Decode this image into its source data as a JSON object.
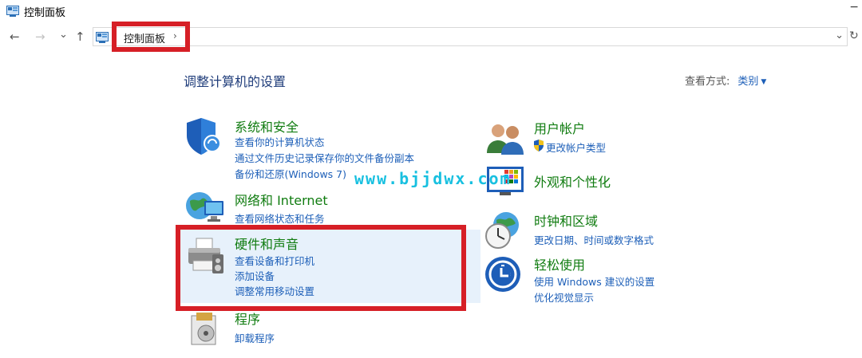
{
  "window": {
    "title": "控制面板",
    "minimize_glyph": "−"
  },
  "nav": {
    "back_glyph": "←",
    "forward_glyph": "→",
    "recent_glyph": "⌄",
    "up_glyph": "↑",
    "breadcrumb": "控制面板",
    "breadcrumb_chevron": "›",
    "address_dropdown": "⌄",
    "refresh_glyph": "↻"
  },
  "main": {
    "heading": "调整计算机的设置",
    "view_by_label": "查看方式:",
    "view_by_value": "类别",
    "view_by_caret": "▼"
  },
  "categories": [
    {
      "title": "系统和安全",
      "icon": "shield-icon",
      "links": [
        "查看你的计算机状态",
        "通过文件历史记录保存你的文件备份副本",
        "备份和还原(Windows 7)"
      ]
    },
    {
      "title": "网络和 Internet",
      "icon": "network-globe-icon",
      "links": [
        "查看网络状态和任务"
      ]
    },
    {
      "title": "硬件和声音",
      "icon": "printer-icon",
      "links": [
        "查看设备和打印机",
        "添加设备",
        "调整常用移动设置"
      ]
    },
    {
      "title": "程序",
      "icon": "programs-icon",
      "links": [
        "卸载程序"
      ]
    },
    {
      "title": "用户帐户",
      "icon": "users-icon",
      "links": [
        "更改帐户类型"
      ]
    },
    {
      "title": "外观和个性化",
      "icon": "appearance-icon",
      "links": []
    },
    {
      "title": "时钟和区域",
      "icon": "clock-globe-icon",
      "links": [
        "更改日期、时间或数字格式"
      ]
    },
    {
      "title": "轻松使用",
      "icon": "ease-of-access-icon",
      "links": [
        "使用 Windows 建议的设置",
        "优化视觉显示"
      ]
    }
  ],
  "watermark": "www.bjjdwx.com",
  "colors": {
    "title_green": "#107c10",
    "link_blue": "#1d5fb8",
    "highlight_red": "#d61f26",
    "hover_bg": "#e7f1fb"
  }
}
